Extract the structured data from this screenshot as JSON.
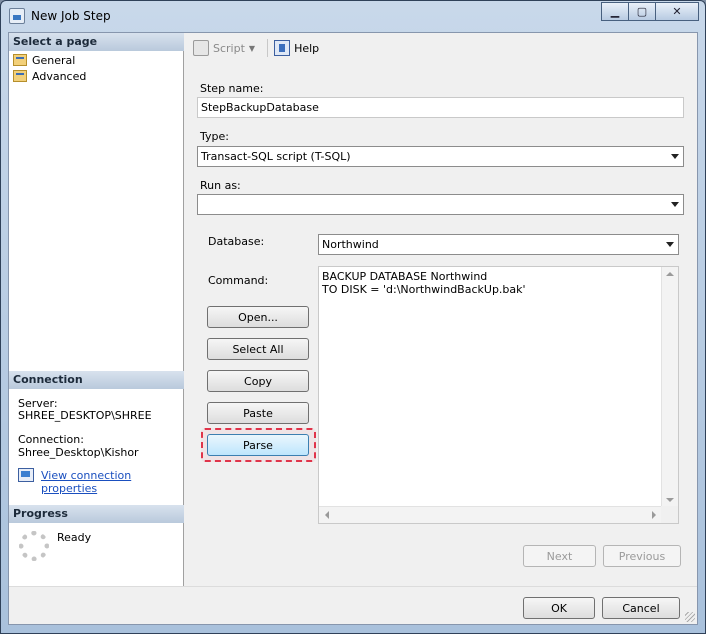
{
  "window": {
    "title": "New Job Step",
    "icon": "job-step-app-icon",
    "controls": {
      "minimize": "▁",
      "maximize": "▢",
      "close": "✕"
    }
  },
  "sidebar": {
    "select_page_header": "Select a page",
    "pages": [
      {
        "label": "General",
        "icon": "page-icon",
        "selected": true
      },
      {
        "label": "Advanced",
        "icon": "page-icon",
        "selected": false
      }
    ],
    "connection_header": "Connection",
    "server_label": "Server:",
    "server_value": "SHREE_DESKTOP\\SHREE",
    "connection_label": "Connection:",
    "connection_value": "Shree_Desktop\\Kishor",
    "view_connection_link": "View connection properties",
    "progress_header": "Progress",
    "progress_status": "Ready"
  },
  "toolbar": {
    "script_label": "Script",
    "help_label": "Help"
  },
  "form": {
    "step_name_label": "Step name:",
    "step_name_value": "StepBackupDatabase",
    "type_label": "Type:",
    "type_value": "Transact-SQL script (T-SQL)",
    "run_as_label": "Run as:",
    "run_as_value": "",
    "database_label": "Database:",
    "database_value": "Northwind",
    "command_label": "Command:",
    "command_text": "BACKUP DATABASE Northwind\nTO DISK = 'd:\\NorthwindBackUp.bak'",
    "buttons": {
      "open": "Open...",
      "select_all": "Select All",
      "copy": "Copy",
      "paste": "Paste",
      "parse": "Parse"
    }
  },
  "navigation": {
    "next": "Next",
    "previous": "Previous"
  },
  "footer": {
    "ok": "OK",
    "cancel": "Cancel"
  },
  "colors": {
    "highlight": "#e0344a",
    "link": "#1a4fbf",
    "focus_border": "#3c7fb1"
  }
}
